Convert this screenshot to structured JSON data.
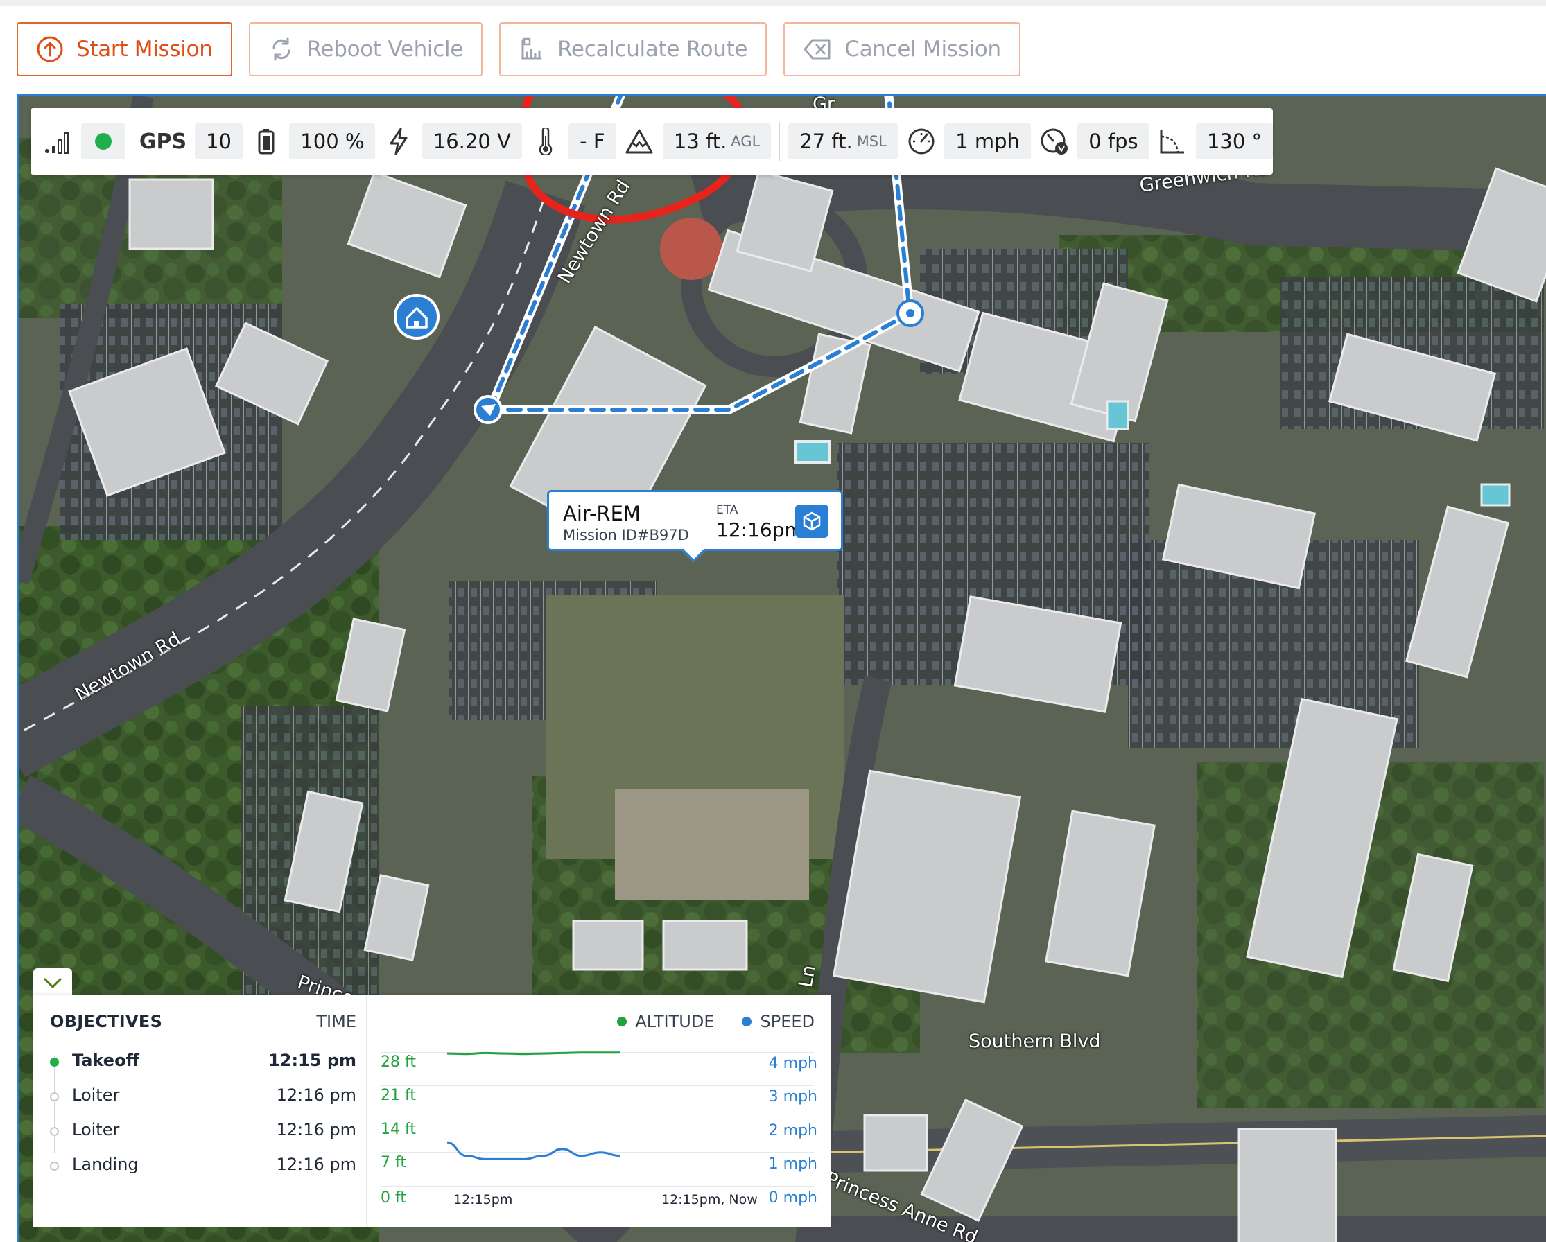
{
  "toolbar": {
    "start_mission": "Start Mission",
    "reboot_vehicle": "Reboot Vehicle",
    "recalculate_route": "Recalculate Route",
    "cancel_mission": "Cancel Mission"
  },
  "telemetry": {
    "signal_icon": "signal-strength-icon",
    "status_color": "#1fb04b",
    "gps_label": "GPS",
    "gps_count": "10",
    "battery_percent": "100 %",
    "voltage": "16.20 V",
    "temperature": "- F",
    "altitude_agl_value": "13 ft.",
    "altitude_agl_unit": "AGL",
    "altitude_msl_value": "27 ft.",
    "altitude_msl_unit": "MSL",
    "speed": "1 mph",
    "vertical_speed": "0 fps",
    "heading": "130 °"
  },
  "map": {
    "streets": {
      "newtown_rd_north": "Newtown Rd",
      "newtown_rd_west": "Newtown Rd",
      "greenwich_rd": "Greenwich Rd",
      "southern_blvd": "Southern Blvd",
      "princess_anne_rd_left": "Princess",
      "princess_anne_rd_right": "Princess Anne Rd",
      "lane_label": "Ln",
      "top_partial": "Gr"
    },
    "route_color": "#2a7fd4"
  },
  "vehicle_callout": {
    "name": "Air-REM",
    "mission_id": "Mission ID#B97D",
    "eta_label": "ETA",
    "eta_time": "12:16pm"
  },
  "objectives": {
    "header": "OBJECTIVES",
    "time_header": "TIME",
    "items": [
      {
        "name": "Takeoff",
        "time": "12:15 pm",
        "status": "complete"
      },
      {
        "name": "Loiter",
        "time": "12:16 pm",
        "status": "pending"
      },
      {
        "name": "Loiter",
        "time": "12:16 pm",
        "status": "pending"
      },
      {
        "name": "Landing",
        "time": "12:16 pm",
        "status": "pending"
      }
    ]
  },
  "chart": {
    "legend_altitude": "ALTITUDE",
    "legend_speed": "SPEED",
    "altitude_color": "#1fa33f",
    "speed_color": "#2a7fd4",
    "y_left": [
      "28 ft",
      "21 ft",
      "14 ft",
      "7 ft",
      "0 ft"
    ],
    "y_right": [
      "4 mph",
      "3 mph",
      "2 mph",
      "1 mph",
      "0 mph"
    ],
    "x_start": "12:15pm",
    "x_end": "12:15pm, Now"
  },
  "chart_data": {
    "type": "line",
    "x": [
      "12:15pm",
      "12:15pm, Now"
    ],
    "series": [
      {
        "name": "ALTITUDE",
        "unit": "ft",
        "values": [
          27.7,
          27.6,
          27.8,
          27.7,
          27.6,
          27.7,
          27.8,
          27.9,
          27.9,
          27.9
        ]
      },
      {
        "name": "SPEED",
        "unit": "mph",
        "values": [
          1.3,
          0.9,
          0.8,
          0.8,
          0.8,
          0.9,
          1.1,
          0.9,
          1.0,
          0.9
        ]
      }
    ],
    "ylim_left": [
      0,
      28
    ],
    "ylim_right": [
      0,
      4
    ]
  }
}
